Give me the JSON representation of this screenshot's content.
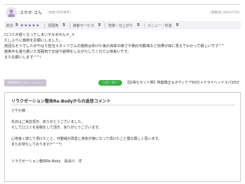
{
  "reviewer": {
    "name": "さやか さん",
    "meta": "（女性/30代後半）",
    "post_date": "[投稿日] 2023/7/29"
  },
  "ratings": {
    "overall_label": "総合",
    "overall_value": "5",
    "overall_stars": "★★★★★",
    "star_color": "#7c62a6",
    "items": [
      {
        "label": "雰囲気",
        "value": "5"
      },
      {
        "label": "接客サービス",
        "value": "5"
      },
      {
        "label": "技術・仕上がり",
        "value": "5"
      },
      {
        "label": "メニュー・料金",
        "value": "5"
      }
    ]
  },
  "comment": [
    "口コミが遅くなってしまいすみません＊_＊",
    "久しぶりに施術をお願いしました。",
    "前回もそうでしたがやはり担当スタッフさんの施術は受けた後の身体の楽さや腕の可動域など効果が目に見えてわかって嬉しいです^^",
    "施術中も落ち着いた雰囲気でお話や説明をしながらしてくれて心地良いです。",
    "またお願いします^^！"
  ],
  "menu": {
    "coupon_tag": "予約時のクーポン・メニュー",
    "visit_badge": "リピーター",
    "text": "【お得なセット券】骨盤矯正＆ボディケア60分＋ドライヘッドスパ20分",
    "badge_color": "#3fae47"
  },
  "reply": {
    "title": "リラクゼーション整体Re.Bodyからの返信コメント",
    "lines": [
      "さやか様",
      "",
      "先日はご来店頂き、ありがとうございました。",
      "そして口コミを投稿をして頂き、ありがとうございます。",
      "",
      "心地良く感じて頂けたこと、可動域が改善し身体が楽になって頂けたこと僕も嬉しく思います。",
      "またお待ちしております(*^^*)",
      "",
      "",
      "リラクゼーション整体Re.Body　長谷川　淳"
    ]
  }
}
